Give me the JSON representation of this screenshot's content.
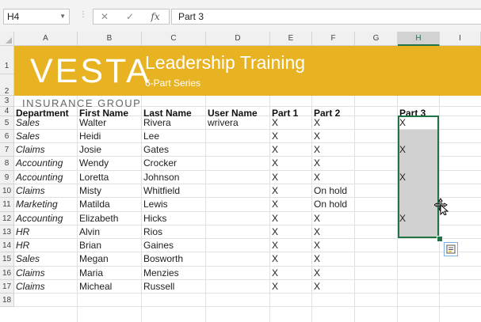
{
  "formula_bar": {
    "name_box": "H4",
    "cancel_glyph": "✕",
    "enter_glyph": "✓",
    "fx_label": "fx",
    "content": "Part 3"
  },
  "columns": [
    "A",
    "B",
    "C",
    "D",
    "E",
    "F",
    "G",
    "H",
    "I"
  ],
  "selected_column": "H",
  "rows": [
    "1",
    "2",
    "3",
    "4",
    "5",
    "6",
    "7",
    "8",
    "9",
    "10",
    "11",
    "12",
    "13",
    "14",
    "15",
    "16",
    "17",
    "18"
  ],
  "banner": {
    "logo": "VESTA",
    "title": "Leadership Training",
    "subtitle": "6-Part Series",
    "company": "INSURANCE GROUP",
    "color": "#e8b323"
  },
  "table": {
    "headers": [
      "Department",
      "First Name",
      "Last Name",
      "User Name",
      "Part 1",
      "Part 2",
      "",
      "Part 3"
    ],
    "rows": [
      [
        "Sales",
        "Walter",
        "Rivera",
        "wrivera",
        "X",
        "X",
        "",
        "X"
      ],
      [
        "Sales",
        "Heidi",
        "Lee",
        "",
        "X",
        "X",
        "",
        ""
      ],
      [
        "Claims",
        "Josie",
        "Gates",
        "",
        "X",
        "X",
        "",
        "X"
      ],
      [
        "Accounting",
        "Wendy",
        "Crocker",
        "",
        "X",
        "X",
        "",
        ""
      ],
      [
        "Accounting",
        "Loretta",
        "Johnson",
        "",
        "X",
        "X",
        "",
        "X"
      ],
      [
        "Claims",
        "Misty",
        "Whitfield",
        "",
        "X",
        "On hold",
        "",
        ""
      ],
      [
        "Marketing",
        "Matilda",
        "Lewis",
        "",
        "X",
        "On hold",
        "",
        ""
      ],
      [
        "Accounting",
        "Elizabeth",
        "Hicks",
        "",
        "X",
        "X",
        "",
        "X"
      ],
      [
        "HR",
        "Alvin",
        "Rios",
        "",
        "X",
        "X",
        "",
        ""
      ],
      [
        "HR",
        "Brian",
        "Gaines",
        "",
        "X",
        "X",
        "",
        ""
      ],
      [
        "Sales",
        "Megan",
        "Bosworth",
        "",
        "X",
        "X",
        "",
        ""
      ],
      [
        "Claims",
        "Maria",
        "Menzies",
        "",
        "X",
        "X",
        "",
        ""
      ],
      [
        "Claims",
        "Micheal",
        "Russell",
        "",
        "X",
        "X",
        "",
        ""
      ]
    ]
  },
  "selection_color": "#217346"
}
